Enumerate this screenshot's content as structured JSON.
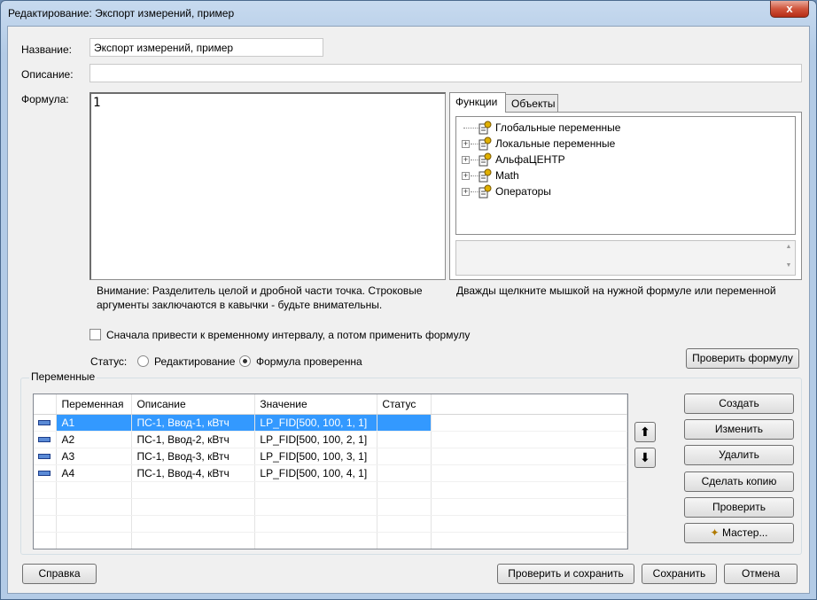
{
  "window": {
    "title": "Редактирование: Экспорт измерений, пример",
    "close_glyph": "x"
  },
  "form": {
    "name_label": "Название:",
    "name_value": "Экспорт измерений, пример",
    "description_label": "Описание:",
    "description_value": "",
    "formula_label": "Формула:",
    "formula_value": "1"
  },
  "tabs": [
    {
      "label": "Функции",
      "active": true
    },
    {
      "label": "Объекты",
      "active": false
    }
  ],
  "tree": [
    {
      "label": "Глобальные переменные",
      "expandable": false
    },
    {
      "label": "Локальные переменные",
      "expandable": true
    },
    {
      "label": "АльфаЦЕНТР",
      "expandable": true
    },
    {
      "label": "Math",
      "expandable": true
    },
    {
      "label": "Операторы",
      "expandable": true
    }
  ],
  "notes": {
    "warning_line1": "Внимание: Разделитель целой и дробной части точка. Строковые",
    "warning_line2": "аргументы заключаются в кавычки - будьте внимательны.",
    "hint": "Дважды щелкните мышкой на нужной формуле или переменной"
  },
  "options": {
    "interval_checkbox_label": "Сначала привести к временному интервалу, а потом применить формулу",
    "interval_checked": false,
    "status_label": "Статус:",
    "status_editing": "Редактирование",
    "status_checked": "Формула проверенна",
    "status_selected": "checked",
    "check_formula_button": "Проверить формулу"
  },
  "variables": {
    "group_title": "Переменные",
    "columns": [
      "Переменная",
      "Описание",
      "Значение",
      "Статус"
    ],
    "rows": [
      {
        "name": "A1",
        "description": "ПС-1, Ввод-1, кВтч",
        "value": "LP_FID[500, 100, 1, 1]",
        "status": "",
        "selected": true
      },
      {
        "name": "A2",
        "description": "ПС-1, Ввод-2, кВтч",
        "value": "LP_FID[500, 100, 2, 1]",
        "status": "",
        "selected": false
      },
      {
        "name": "A3",
        "description": "ПС-1, Ввод-3, кВтч",
        "value": "LP_FID[500, 100, 3, 1]",
        "status": "",
        "selected": false
      },
      {
        "name": "A4",
        "description": "ПС-1, Ввод-4, кВтч",
        "value": "LP_FID[500, 100, 4, 1]",
        "status": "",
        "selected": false
      }
    ],
    "buttons": {
      "create": "Создать",
      "edit": "Изменить",
      "delete": "Удалить",
      "copy": "Сделать копию",
      "check": "Проверить",
      "wizard": "Мастер..."
    }
  },
  "footer": {
    "help": "Справка",
    "check_and_save": "Проверить и сохранить",
    "save": "Сохранить",
    "cancel": "Отмена"
  }
}
